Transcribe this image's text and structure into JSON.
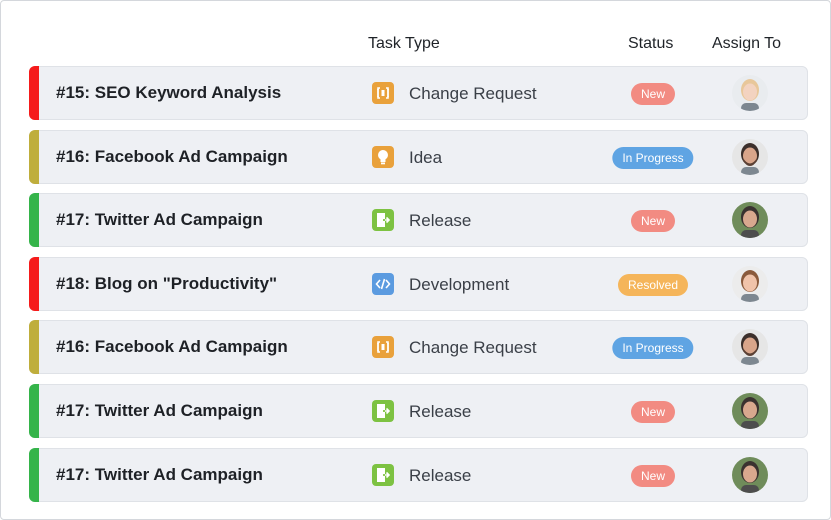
{
  "header": {
    "task_type": "Task Type",
    "status": "Status",
    "assign_to": "Assign To"
  },
  "colors": {
    "red": "#f51b1b",
    "olive": "#bfae3c",
    "green": "#35b44a",
    "status_new": "#f28b82",
    "status_in_progress": "#5fa4e3",
    "status_resolved": "#f5b55a",
    "icon_orange": "#e9a13b",
    "icon_green": "#7dc242",
    "icon_blue": "#5b9be0"
  },
  "rows": [
    {
      "title": "#15: SEO Keyword Analysis",
      "priority_color": "red",
      "type": "Change Request",
      "type_icon": "change-request-icon",
      "status": "New",
      "status_kind": "new",
      "assignee": "woman-blonde"
    },
    {
      "title": "#16: Facebook Ad Campaign",
      "priority_color": "olive",
      "type": "Idea",
      "type_icon": "lightbulb-icon",
      "status": "In Progress",
      "status_kind": "in_progress",
      "assignee": "man-beard"
    },
    {
      "title": "#17: Twitter Ad Campaign",
      "priority_color": "green",
      "type": "Release",
      "type_icon": "release-icon",
      "status": "New",
      "status_kind": "new",
      "assignee": "man-smile"
    },
    {
      "title": "#18: Blog on \"Productivity\"",
      "priority_color": "red",
      "type": "Development",
      "type_icon": "code-icon",
      "status": "Resolved",
      "status_kind": "resolved",
      "assignee": "woman-brunette"
    },
    {
      "title": "#16: Facebook Ad Campaign",
      "priority_color": "olive",
      "type": "Change Request",
      "type_icon": "change-request-icon",
      "status": "In Progress",
      "status_kind": "in_progress",
      "assignee": "man-beard"
    },
    {
      "title": "#17: Twitter Ad Campaign",
      "priority_color": "green",
      "type": "Release",
      "type_icon": "release-icon",
      "status": "New",
      "status_kind": "new",
      "assignee": "man-smile"
    },
    {
      "title": "#17: Twitter Ad Campaign",
      "priority_color": "green",
      "type": "Release",
      "type_icon": "release-icon",
      "status": "New",
      "status_kind": "new",
      "assignee": "man-smile"
    }
  ]
}
